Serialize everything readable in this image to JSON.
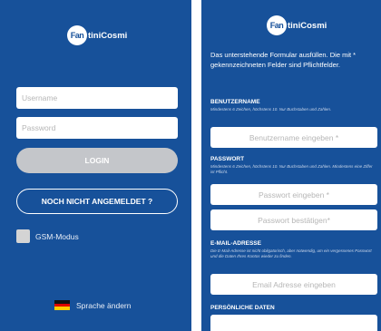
{
  "left": {
    "logo": {
      "mark": "Fan",
      "text": "tiniCosmi"
    },
    "username_placeholder": "Username",
    "password_placeholder": "Password",
    "login_label": "LOGIN",
    "register_label": "NOCH NICHT ANGEMELDET ?",
    "gsm_label": "GSM-Modus",
    "language_label": "Sprache ändern"
  },
  "right": {
    "logo": {
      "mark": "Fan",
      "text": "tiniCosmi"
    },
    "intro": "Das unterstehende Formular ausfüllen. Die mit * gekennzeichneten Felder sind Pflichtfelder.",
    "username_section": {
      "title": "BENUTZERNAME",
      "hint": "Mindestens 6 Zeichen, höchstens 10. Nur Buchstaben und Zahlen.",
      "placeholder": "Benutzername eingeben *"
    },
    "password_section": {
      "title": "PASSWORT",
      "hint": "Mindestens 6 Zeichen, höchstens 10. Nur Buchstaben und Zahlen. Mindestens eine Ziffer ist Pflicht.",
      "placeholder": "Passwort eingeben *",
      "confirm_placeholder": "Passwort bestätigen*"
    },
    "email_section": {
      "title": "E-MAIL-ADRESSE",
      "hint": "Die E-Mail-Adresse ist nicht obligatorisch, aber notwendig, um ein vergessenes Passwort und die Daten Ihres Kontos wieder zu finden.",
      "placeholder": "Email Adresse eingeben"
    },
    "personal_section": {
      "title": "PERSÖNLICHE DATEN"
    }
  },
  "colors": {
    "background": "#17519a",
    "login_button": "#c4c6ca",
    "flag": [
      "#111111",
      "#dd0000",
      "#ffcc00"
    ]
  }
}
